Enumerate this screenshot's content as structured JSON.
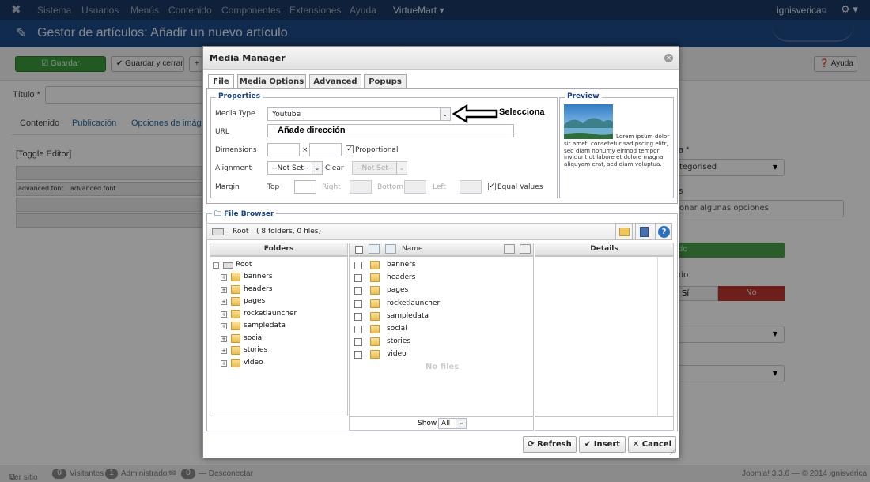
{
  "topbar": {
    "items": [
      "Sistema",
      "Usuarios",
      "Menús",
      "Contenido",
      "Componentes",
      "Extensiones",
      "Ayuda"
    ],
    "virtuemart": "VirtueMart",
    "user": "ignisverica"
  },
  "header": {
    "title": "Gestor de artículos: Añadir un nuevo artículo"
  },
  "toolbar": {
    "save": "Guardar",
    "save_close": "Guardar y cerrar",
    "help": "Ayuda"
  },
  "form": {
    "title_label": "Título *",
    "tabs": [
      "Contenido",
      "Publicación",
      "Opciones de imágenes"
    ],
    "toggle_editor": "[Toggle Editor]",
    "font_family": "advanced.font",
    "font_size": "advanced.font"
  },
  "right_panel": {
    "category_label": "a *",
    "category_value": "tegorised",
    "tags_label": "s",
    "tags_placeholder": "onar algunas opciones",
    "status_value": "do",
    "featured_label": "do",
    "yes": "Sí",
    "no": "No"
  },
  "footer": {
    "view_site": "Ver sitio",
    "visitors_count": "0",
    "visitors": "Visitantes",
    "admin_count": "1",
    "admin": "Administrador",
    "msg_count": "0",
    "logout": "— Desconectar",
    "version": "Joomla! 3.3.6 — © 2014 ignisverica"
  },
  "dialog": {
    "title": "Media Manager",
    "tabs": [
      "File",
      "Media Options",
      "Advanced",
      "Popups"
    ],
    "properties": {
      "legend": "Properties",
      "media_type_label": "Media Type",
      "media_type_value": "Youtube",
      "url_label": "URL",
      "url_value": "Añade dirección",
      "dimensions_label": "Dimensions",
      "dim_sep": "×",
      "proportional": "Proportional",
      "alignment_label": "Alignment",
      "alignment_value": "--Not Set--",
      "clear_label": "Clear",
      "clear_value": "--Not Set--",
      "margin_label": "Margin",
      "top": "Top",
      "right": "Right",
      "bottom": "Bottom",
      "left": "Left",
      "equal_values": "Equal Values"
    },
    "annotation": "Selecciona",
    "preview": {
      "legend": "Preview",
      "text": "Lorem ipsum dolor sit amet, consetetur sadipscing elitr, sed diam nonumy eirmod tempor invidunt ut labore et dolore magna aliquyam erat, sed diam voluptua."
    },
    "file_browser": {
      "legend": "File Browser",
      "path": "Root",
      "summary": "( 8 folders, 0 files)",
      "folders_header": "Folders",
      "name_header": "Name",
      "details_header": "Details",
      "root": "Root",
      "folders": [
        "banners",
        "headers",
        "pages",
        "rocketlauncher",
        "sampledata",
        "social",
        "stories",
        "video"
      ],
      "no_files": "No files",
      "show_label": "Show",
      "show_value": "All"
    },
    "buttons": {
      "refresh": "Refresh",
      "insert": "Insert",
      "cancel": "Cancel"
    }
  }
}
